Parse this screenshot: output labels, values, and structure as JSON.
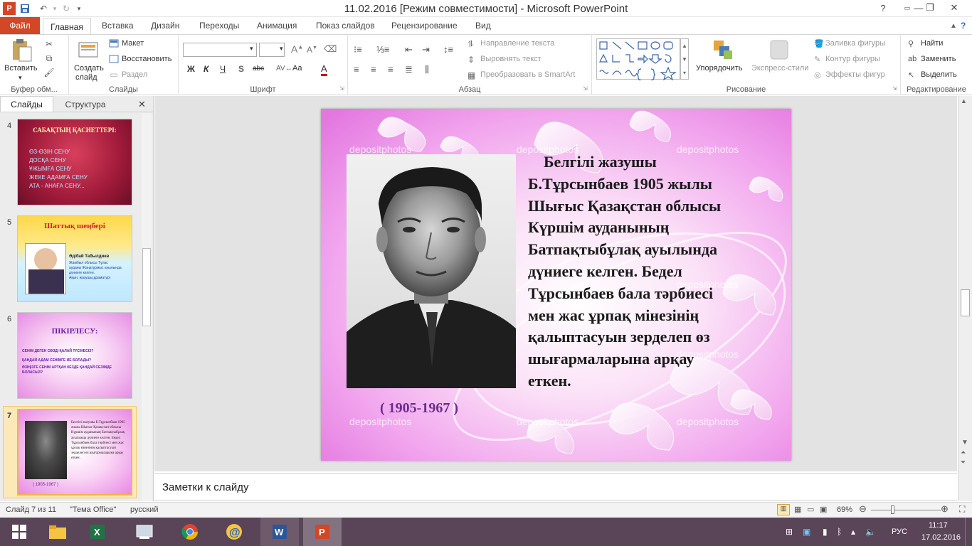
{
  "window": {
    "title": "11.02.2016 [Режим совместимости]  -  Microsoft PowerPoint",
    "help_icon": "help-icon"
  },
  "tabs": {
    "file": "Файл",
    "items": [
      "Главная",
      "Вставка",
      "Дизайн",
      "Переходы",
      "Анимация",
      "Показ слайдов",
      "Рецензирование",
      "Вид"
    ]
  },
  "ribbon": {
    "clipboard": {
      "paste": "Вставить",
      "label": "Буфер обм..."
    },
    "slides": {
      "new_slide_1": "Создать",
      "new_slide_2": "слайд",
      "layout": "Макет",
      "reset": "Восстановить",
      "section": "Раздел",
      "label": "Слайды"
    },
    "font": {
      "label": "Шрифт",
      "bold": "Ж",
      "italic": "К",
      "underline": "Ч",
      "shadow": "S",
      "strike": "abc",
      "aa": "Aa",
      "a_color": "A"
    },
    "paragraph": {
      "text_direction": "Направление текста",
      "align_text": "Выровнять текст",
      "smartart": "Преобразовать в SmartArt",
      "label": "Абзац"
    },
    "drawing": {
      "arrange": "Упорядочить",
      "quick_styles": "Экспресс-стили",
      "fill": "Заливка фигуры",
      "outline": "Контур фигуры",
      "effects": "Эффекты фигур",
      "label": "Рисование"
    },
    "editing": {
      "find": "Найти",
      "replace": "Заменить",
      "select": "Выделить",
      "label": "Редактирование"
    }
  },
  "left_pane": {
    "tab_slides": "Слайды",
    "tab_outline": "Структура",
    "thumbs": [
      {
        "num": "4",
        "title": "САБАҚТЫҢ ҚАСИЕТТЕРІ:",
        "lines": [
          "ӨЗ-ӨЗІН СЕНУ",
          "ДОСҚА СЕНУ",
          "ҰЖЫМҒА СЕНУ",
          "ЖЕКЕ АДАМҒА СЕНУ",
          "АТА - АНАҒА СЕНУ..."
        ]
      },
      {
        "num": "5",
        "title": "Шаттық шеңбері",
        "name": "Әдібай Табылдиев",
        "lines": [
          "Жамбыл облысы Тұлас",
          "ауданы Жаңатұрмыс ауылында",
          "дүниеге келген.",
          "Ақын, жазушы,драматург"
        ]
      },
      {
        "num": "6",
        "title": "ПІКІРЛЕСУ:",
        "lines": [
          "СЕНІМ ДЕГЕН СӨЗДІ ҚАЛАЙ ТҮСІНЕСІЗ?",
          "ҚАНДАЙ АДАМ СЕНІМГЕ ИЕ БОЛАДЫ?",
          "ӨЗІҢІЗГЕ СЕНІМ АРТҚАН КЕЗДЕ ҚАНДАЙ СЕЗІМДЕ БОЛАСЫЗ?"
        ]
      },
      {
        "num": "7",
        "years": "( 1905-1967 )"
      }
    ]
  },
  "slide": {
    "text": "Белгілі жазушы Б.Тұрсынбаев 1905 жылы Шығыс Қазақстан облысы Күршім  ауданының Батпақтыбұлақ ауылында дүниеге келген.   Бедел Тұрсынбаев бала тәрбиесі мен  жас ұрпақ мінезінің қалыптасуын зерделеп өз шығармаларына арқау еткен.",
    "lines": [
      "Белгілі жазушы",
      "Б.Тұрсынбаев 1905 жылы",
      "Шығыс Қазақстан облысы",
      "Күршім  ауданының",
      "Батпақтыбұлақ ауылында",
      "дүниеге келген.   Бедел",
      "Тұрсынбаев бала тәрбиесі",
      "мен  жас ұрпақ мінезінің",
      "қалыптасуын зерделеп өз",
      "шығармаларына арқау",
      "еткен."
    ],
    "years": "( 1905-1967 )",
    "watermark": "depositphotos"
  },
  "notes": {
    "placeholder": "Заметки к слайду"
  },
  "status": {
    "slide_of": "Слайд 7 из 11",
    "theme": "\"Тема Office\"",
    "lang": "русский",
    "zoom": "69%"
  },
  "taskbar": {
    "lang": "РУС",
    "time": "11:17",
    "date": "17.02.2016"
  },
  "colors": {
    "accent": "#d24726",
    "taskbar": "#5a4457",
    "slide_text": "#1a1a1a",
    "years": "#6a2c8c"
  }
}
